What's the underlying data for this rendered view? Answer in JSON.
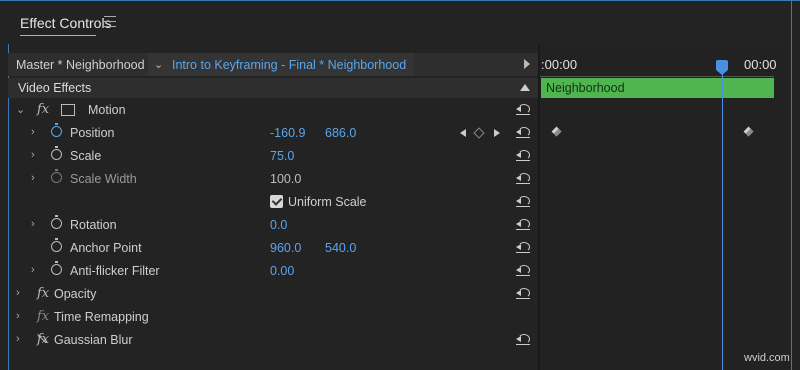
{
  "panel": {
    "title": "Effect Controls",
    "menu_icon": "hamburger-menu-icon"
  },
  "source": {
    "master_label": "Master * Neighborhood",
    "selected_clip": "Intro to Keyframing - Final * Neighborhood"
  },
  "timeline": {
    "timecode_start": ":00:00",
    "timecode_end": "00:00",
    "clip_name": "Neighborhood",
    "clip_color": "#4fb64f",
    "playhead_color": "#4a8fe0"
  },
  "effects": {
    "section_title": "Video Effects",
    "motion": {
      "name": "Motion",
      "position": {
        "label": "Position",
        "x": "-160.9",
        "y": "686.0"
      },
      "scale": {
        "label": "Scale",
        "value": "75.0"
      },
      "scale_width": {
        "label": "Scale Width",
        "value": "100.0"
      },
      "uniform_scale": {
        "label": "Uniform Scale",
        "checked": true
      },
      "rotation": {
        "label": "Rotation",
        "value": "0.0"
      },
      "anchor_point": {
        "label": "Anchor Point",
        "x": "960.0",
        "y": "540.0"
      },
      "anti_flicker": {
        "label": "Anti-flicker Filter",
        "value": "0.00"
      }
    },
    "opacity": {
      "name": "Opacity"
    },
    "time_remapping": {
      "name": "Time Remapping"
    },
    "gaussian_blur": {
      "name": "Gaussian Blur"
    }
  },
  "accent_color": "#5aa6ec",
  "watermark": "wvid.com"
}
